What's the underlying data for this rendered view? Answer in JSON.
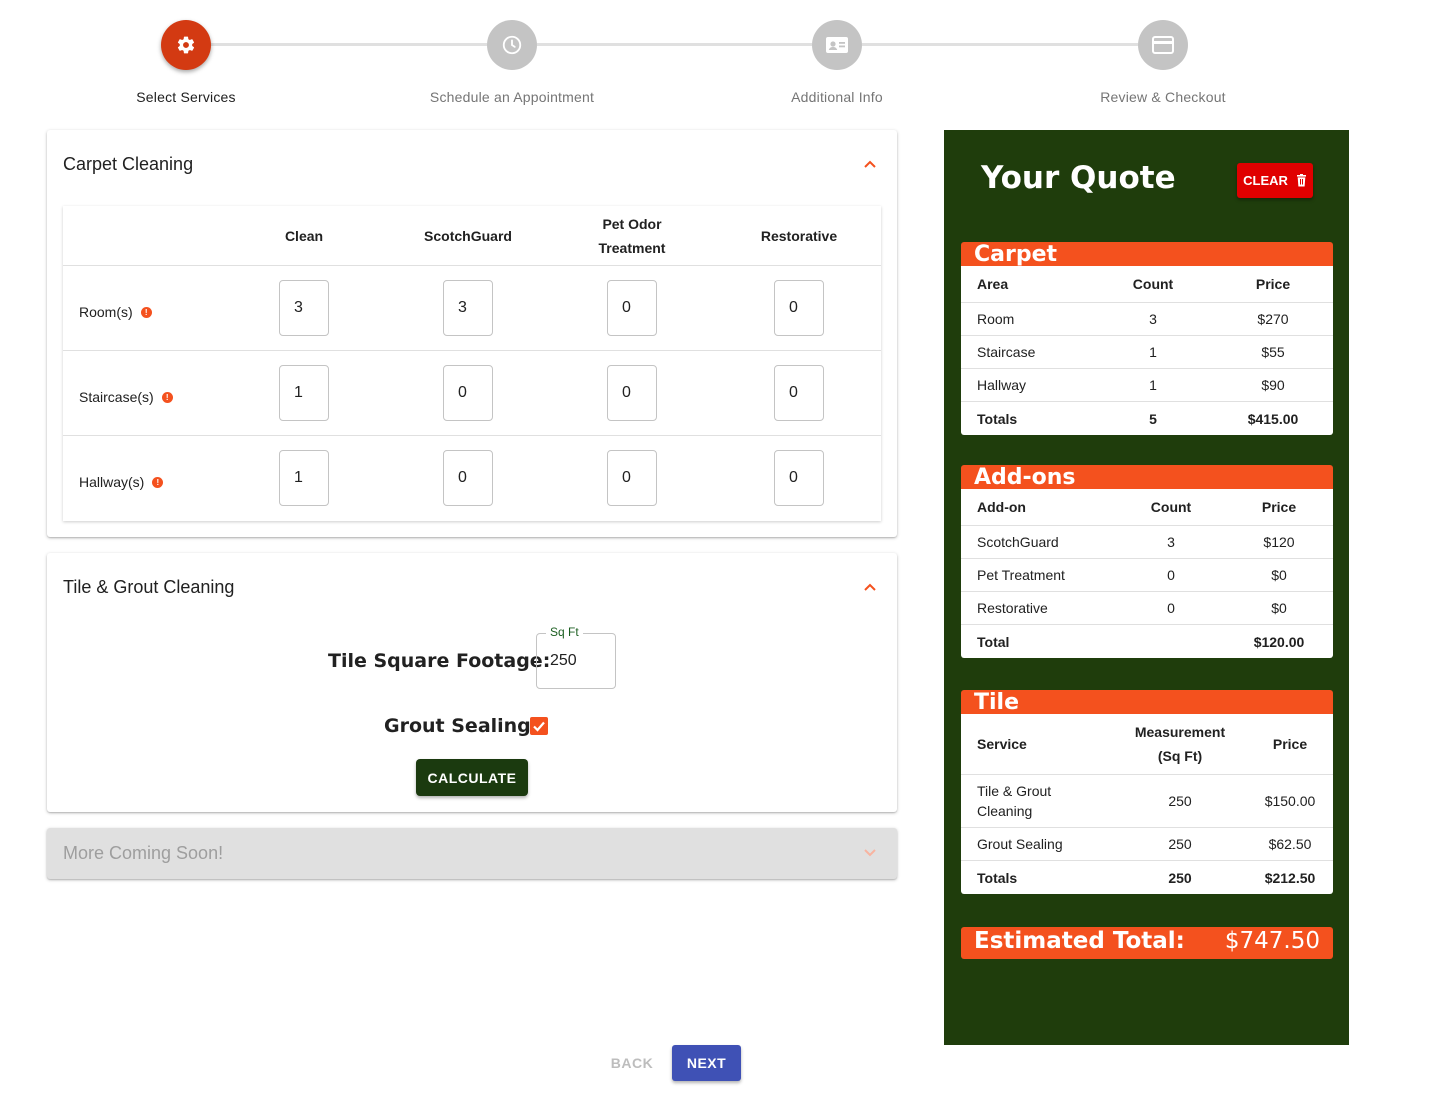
{
  "stepper": {
    "steps": [
      {
        "label": "Select Services",
        "icon": "gear-icon",
        "active": true
      },
      {
        "label": "Schedule an Appointment",
        "icon": "clock-icon",
        "active": false
      },
      {
        "label": "Additional Info",
        "icon": "contact-card-icon",
        "active": false
      },
      {
        "label": "Review & Checkout",
        "icon": "credit-card-icon",
        "active": false
      }
    ]
  },
  "carpet": {
    "title": "Carpet Cleaning",
    "columns": [
      "Clean",
      "ScotchGuard",
      "Pet Odor Treatment",
      "Restorative"
    ],
    "rows": [
      {
        "label": "Room(s)",
        "values": [
          "3",
          "3",
          "0",
          "0"
        ]
      },
      {
        "label": "Staircase(s)",
        "values": [
          "1",
          "0",
          "0",
          "0"
        ]
      },
      {
        "label": "Hallway(s)",
        "values": [
          "1",
          "0",
          "0",
          "0"
        ]
      }
    ]
  },
  "tile": {
    "title": "Tile & Grout Cleaning",
    "sqft_label": "Tile Square Footage:",
    "sqft_legend": "Sq Ft",
    "sqft_value": "250",
    "grout_label": "Grout Sealing?",
    "grout_checked": true,
    "calculate_label": "CALCULATE"
  },
  "more": {
    "title": "More Coming Soon!"
  },
  "quote": {
    "title": "Your Quote",
    "clear_label": "CLEAR",
    "carpet": {
      "title": "Carpet",
      "headers": [
        "Area",
        "Count",
        "Price"
      ],
      "rows": [
        [
          "Room",
          "3",
          "$270"
        ],
        [
          "Staircase",
          "1",
          "$55"
        ],
        [
          "Hallway",
          "1",
          "$90"
        ]
      ],
      "totals": [
        "Totals",
        "5",
        "$415.00"
      ]
    },
    "addons": {
      "title": "Add-ons",
      "headers": [
        "Add-on",
        "Count",
        "Price"
      ],
      "rows": [
        [
          "ScotchGuard",
          "3",
          "$120"
        ],
        [
          "Pet Treatment",
          "0",
          "$0"
        ],
        [
          "Restorative",
          "0",
          "$0"
        ]
      ],
      "totals": [
        "Total",
        "",
        "$120.00"
      ]
    },
    "tile": {
      "title": "Tile",
      "headers": [
        "Service",
        "Measurement (Sq Ft)",
        "Price"
      ],
      "rows": [
        [
          "Tile & Grout Cleaning",
          "250",
          "$150.00"
        ],
        [
          "Grout Sealing",
          "250",
          "$62.50"
        ]
      ],
      "totals": [
        "Totals",
        "250",
        "$212.50"
      ]
    },
    "estimated_label": "Estimated Total:",
    "estimated_value": "$747.50"
  },
  "nav": {
    "back_label": "BACK",
    "next_label": "NEXT"
  },
  "colors": {
    "accent": "#f4511e",
    "active_step": "#d33a12",
    "sidebar": "#1f3d0c",
    "calculate": "#1b3a0f",
    "next": "#3f51b5",
    "clear": "#e00000"
  }
}
